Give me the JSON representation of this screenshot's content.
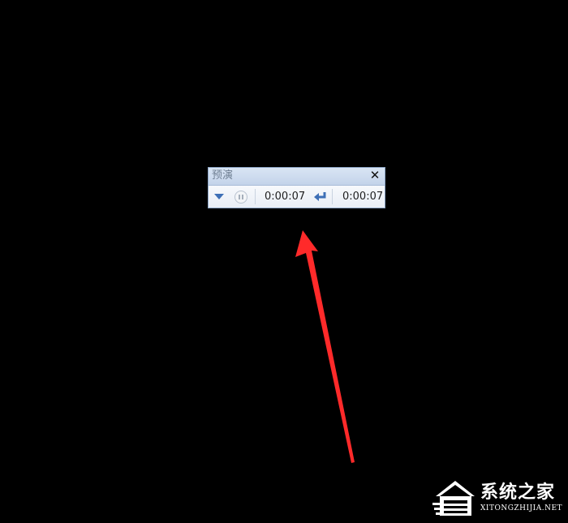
{
  "preview_toolbar": {
    "title": "预演",
    "close_label": "✕",
    "current_time": "0:00:07",
    "total_time": "0:00:07"
  },
  "watermark": {
    "site_name": "系统之家",
    "site_url": "XITONGZHIJIA.NET"
  },
  "colors": {
    "annotation_arrow": "#ff2a2a",
    "icon_blue": "#3d6fb6"
  },
  "icons": {
    "menu": "triangle-down-icon",
    "pause": "pause-icon",
    "return": "return-arrow-icon",
    "close": "close-icon"
  }
}
